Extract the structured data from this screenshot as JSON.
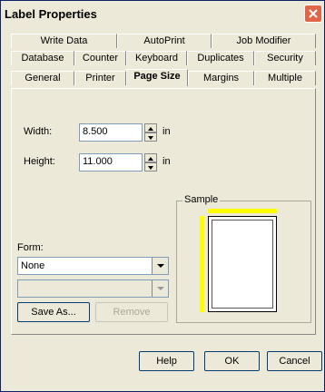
{
  "window": {
    "title": "Label Properties"
  },
  "tabs": {
    "row1": [
      "Write Data",
      "AutoPrint",
      "Job Modifier"
    ],
    "row2": [
      "Database",
      "Counter",
      "Keyboard",
      "Duplicates",
      "Security"
    ],
    "row3": [
      "General",
      "Printer",
      "Page Size",
      "Margins",
      "Multiple"
    ],
    "active": "Page Size"
  },
  "page_size": {
    "width_label": "Width:",
    "width_value": "8.500",
    "height_label": "Height:",
    "height_value": "11.000",
    "unit": "in"
  },
  "form": {
    "label": "Form:",
    "selected": "None",
    "second_selected": "",
    "save_as": "Save As...",
    "remove": "Remove"
  },
  "sample": {
    "title": "Sample"
  },
  "footer": {
    "help": "Help",
    "ok": "OK",
    "cancel": "Cancel"
  },
  "colors": {
    "ruler": "#ffff00",
    "close": "#e0664a"
  }
}
